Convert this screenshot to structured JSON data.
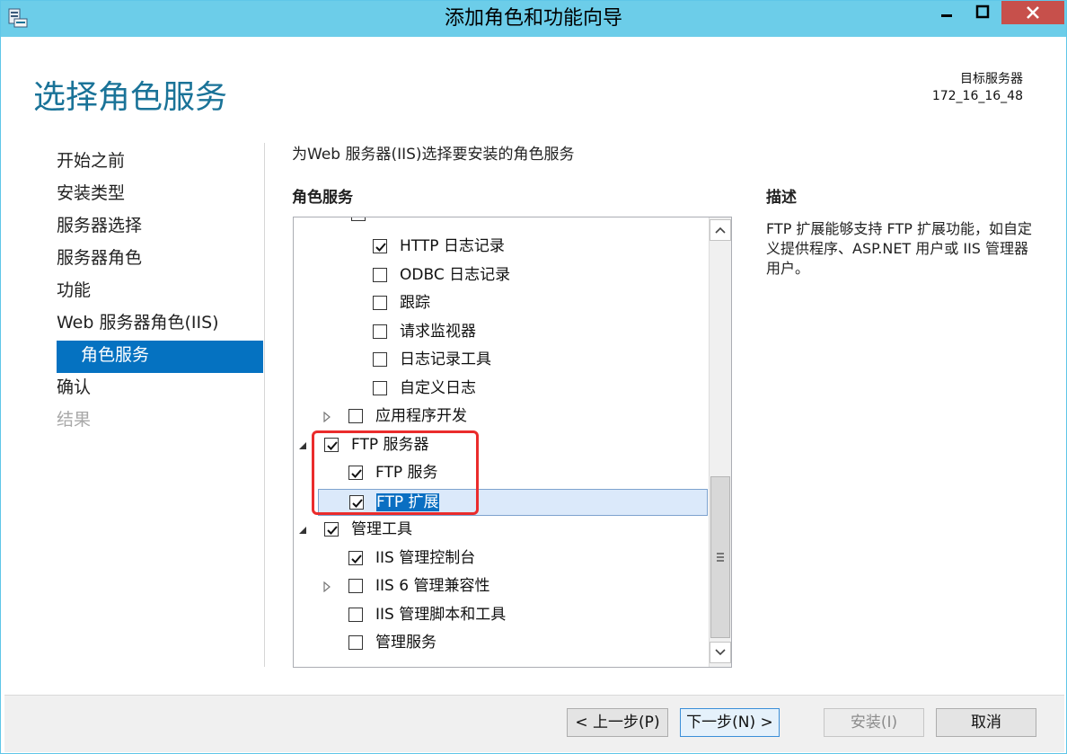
{
  "window": {
    "title": "添加角色和功能向导",
    "icon": "server-manager-icon"
  },
  "page": {
    "title": "选择角色服务",
    "destination_label": "目标服务器",
    "destination_value": "172_16_16_48"
  },
  "nav": {
    "items": [
      {
        "label": "开始之前",
        "state": "normal"
      },
      {
        "label": "安装类型",
        "state": "normal"
      },
      {
        "label": "服务器选择",
        "state": "normal"
      },
      {
        "label": "服务器角色",
        "state": "normal"
      },
      {
        "label": "功能",
        "state": "normal"
      },
      {
        "label": "Web 服务器角色(IIS)",
        "state": "normal"
      },
      {
        "label": "角色服务",
        "state": "active"
      },
      {
        "label": "确认",
        "state": "normal"
      },
      {
        "label": "结果",
        "state": "disabled"
      }
    ]
  },
  "main": {
    "instruction": "为Web 服务器(IIS)选择要安装的角色服务",
    "list_header": "角色服务",
    "tree": [
      {
        "label": "HTTP 日志记录",
        "level": 2,
        "checked": true,
        "expander": "none"
      },
      {
        "label": "ODBC 日志记录",
        "level": 2,
        "checked": false,
        "expander": "none"
      },
      {
        "label": "跟踪",
        "level": 2,
        "checked": false,
        "expander": "none"
      },
      {
        "label": "请求监视器",
        "level": 2,
        "checked": false,
        "expander": "none"
      },
      {
        "label": "日志记录工具",
        "level": 2,
        "checked": false,
        "expander": "none"
      },
      {
        "label": "自定义日志",
        "level": 2,
        "checked": false,
        "expander": "none"
      },
      {
        "label": "应用程序开发",
        "level": 1,
        "checked": false,
        "expander": "collapsed"
      },
      {
        "label": "FTP 服务器",
        "level": 0,
        "checked": true,
        "expander": "expanded"
      },
      {
        "label": "FTP 服务",
        "level": 1,
        "checked": true,
        "expander": "none"
      },
      {
        "label": "FTP 扩展",
        "level": 1,
        "checked": true,
        "expander": "none",
        "selected": true
      },
      {
        "label": "管理工具",
        "level": 0,
        "checked": true,
        "expander": "expanded"
      },
      {
        "label": "IIS 管理控制台",
        "level": 1,
        "checked": true,
        "expander": "none"
      },
      {
        "label": "IIS 6 管理兼容性",
        "level": 1,
        "checked": false,
        "expander": "collapsed"
      },
      {
        "label": "IIS 管理脚本和工具",
        "level": 1,
        "checked": false,
        "expander": "none"
      },
      {
        "label": "管理服务",
        "level": 1,
        "checked": false,
        "expander": "none"
      }
    ]
  },
  "description": {
    "header": "描述",
    "text": "FTP 扩展能够支持 FTP 扩展功能，如自定义提供程序、ASP.NET 用户或 IIS 管理器用户。"
  },
  "footer": {
    "prev_label": "< 上一步(P)",
    "next_label": "下一步(N) >",
    "install_label": "安装(I)",
    "cancel_label": "取消"
  },
  "colors": {
    "titlebar": "#6ccde9",
    "accent": "#0572c1",
    "title_text": "#1a7398",
    "highlight_border": "#ea2c2c",
    "close_button": "#c7504b"
  }
}
